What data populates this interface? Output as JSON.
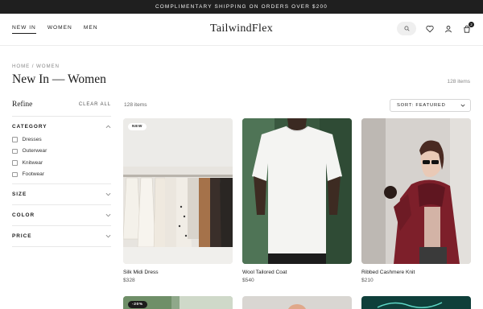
{
  "announcement": "COMPLIMENTARY SHIPPING ON ORDERS OVER $200",
  "nav": [
    {
      "label": "NEW IN",
      "active": true
    },
    {
      "label": "WOMEN",
      "active": false
    },
    {
      "label": "MEN",
      "active": false
    }
  ],
  "brand": "TailwindFlex",
  "header": {
    "cart_count": "2",
    "icons": [
      "search-icon",
      "heart-icon",
      "user-icon",
      "bag-icon"
    ]
  },
  "breadcrumb": "HOME / WOMEN",
  "page_title": "New In — Women",
  "total_count": "128 items",
  "sidebar": {
    "refine": "Refine",
    "clear_all": "CLEAR ALL",
    "category": {
      "title": "CATEGORY",
      "options": [
        "Dresses",
        "Outerwear",
        "Knitwear",
        "Footwear"
      ]
    },
    "size": "SIZE",
    "color": "COLOR",
    "price": "PRICE"
  },
  "toolbar": {
    "items_count": "128 items",
    "sort_label": "SORT: FEATURED"
  },
  "products": [
    {
      "name": "Silk Midi Dress",
      "price": "$328",
      "tag": "NEW"
    },
    {
      "name": "Wool Tailored Coat",
      "price": "$540",
      "tag": ""
    },
    {
      "name": "Ribbed Cashmere Knit",
      "price": "$210",
      "tag": ""
    }
  ],
  "next_row": [
    {
      "tag": "-20%"
    },
    {
      "tag": ""
    },
    {
      "tag": ""
    },
    {
      "tag": ""
    }
  ],
  "colors": {
    "announcement_bg": "#1f1f1f",
    "text": "#1b1b1b",
    "muted": "#888888"
  }
}
